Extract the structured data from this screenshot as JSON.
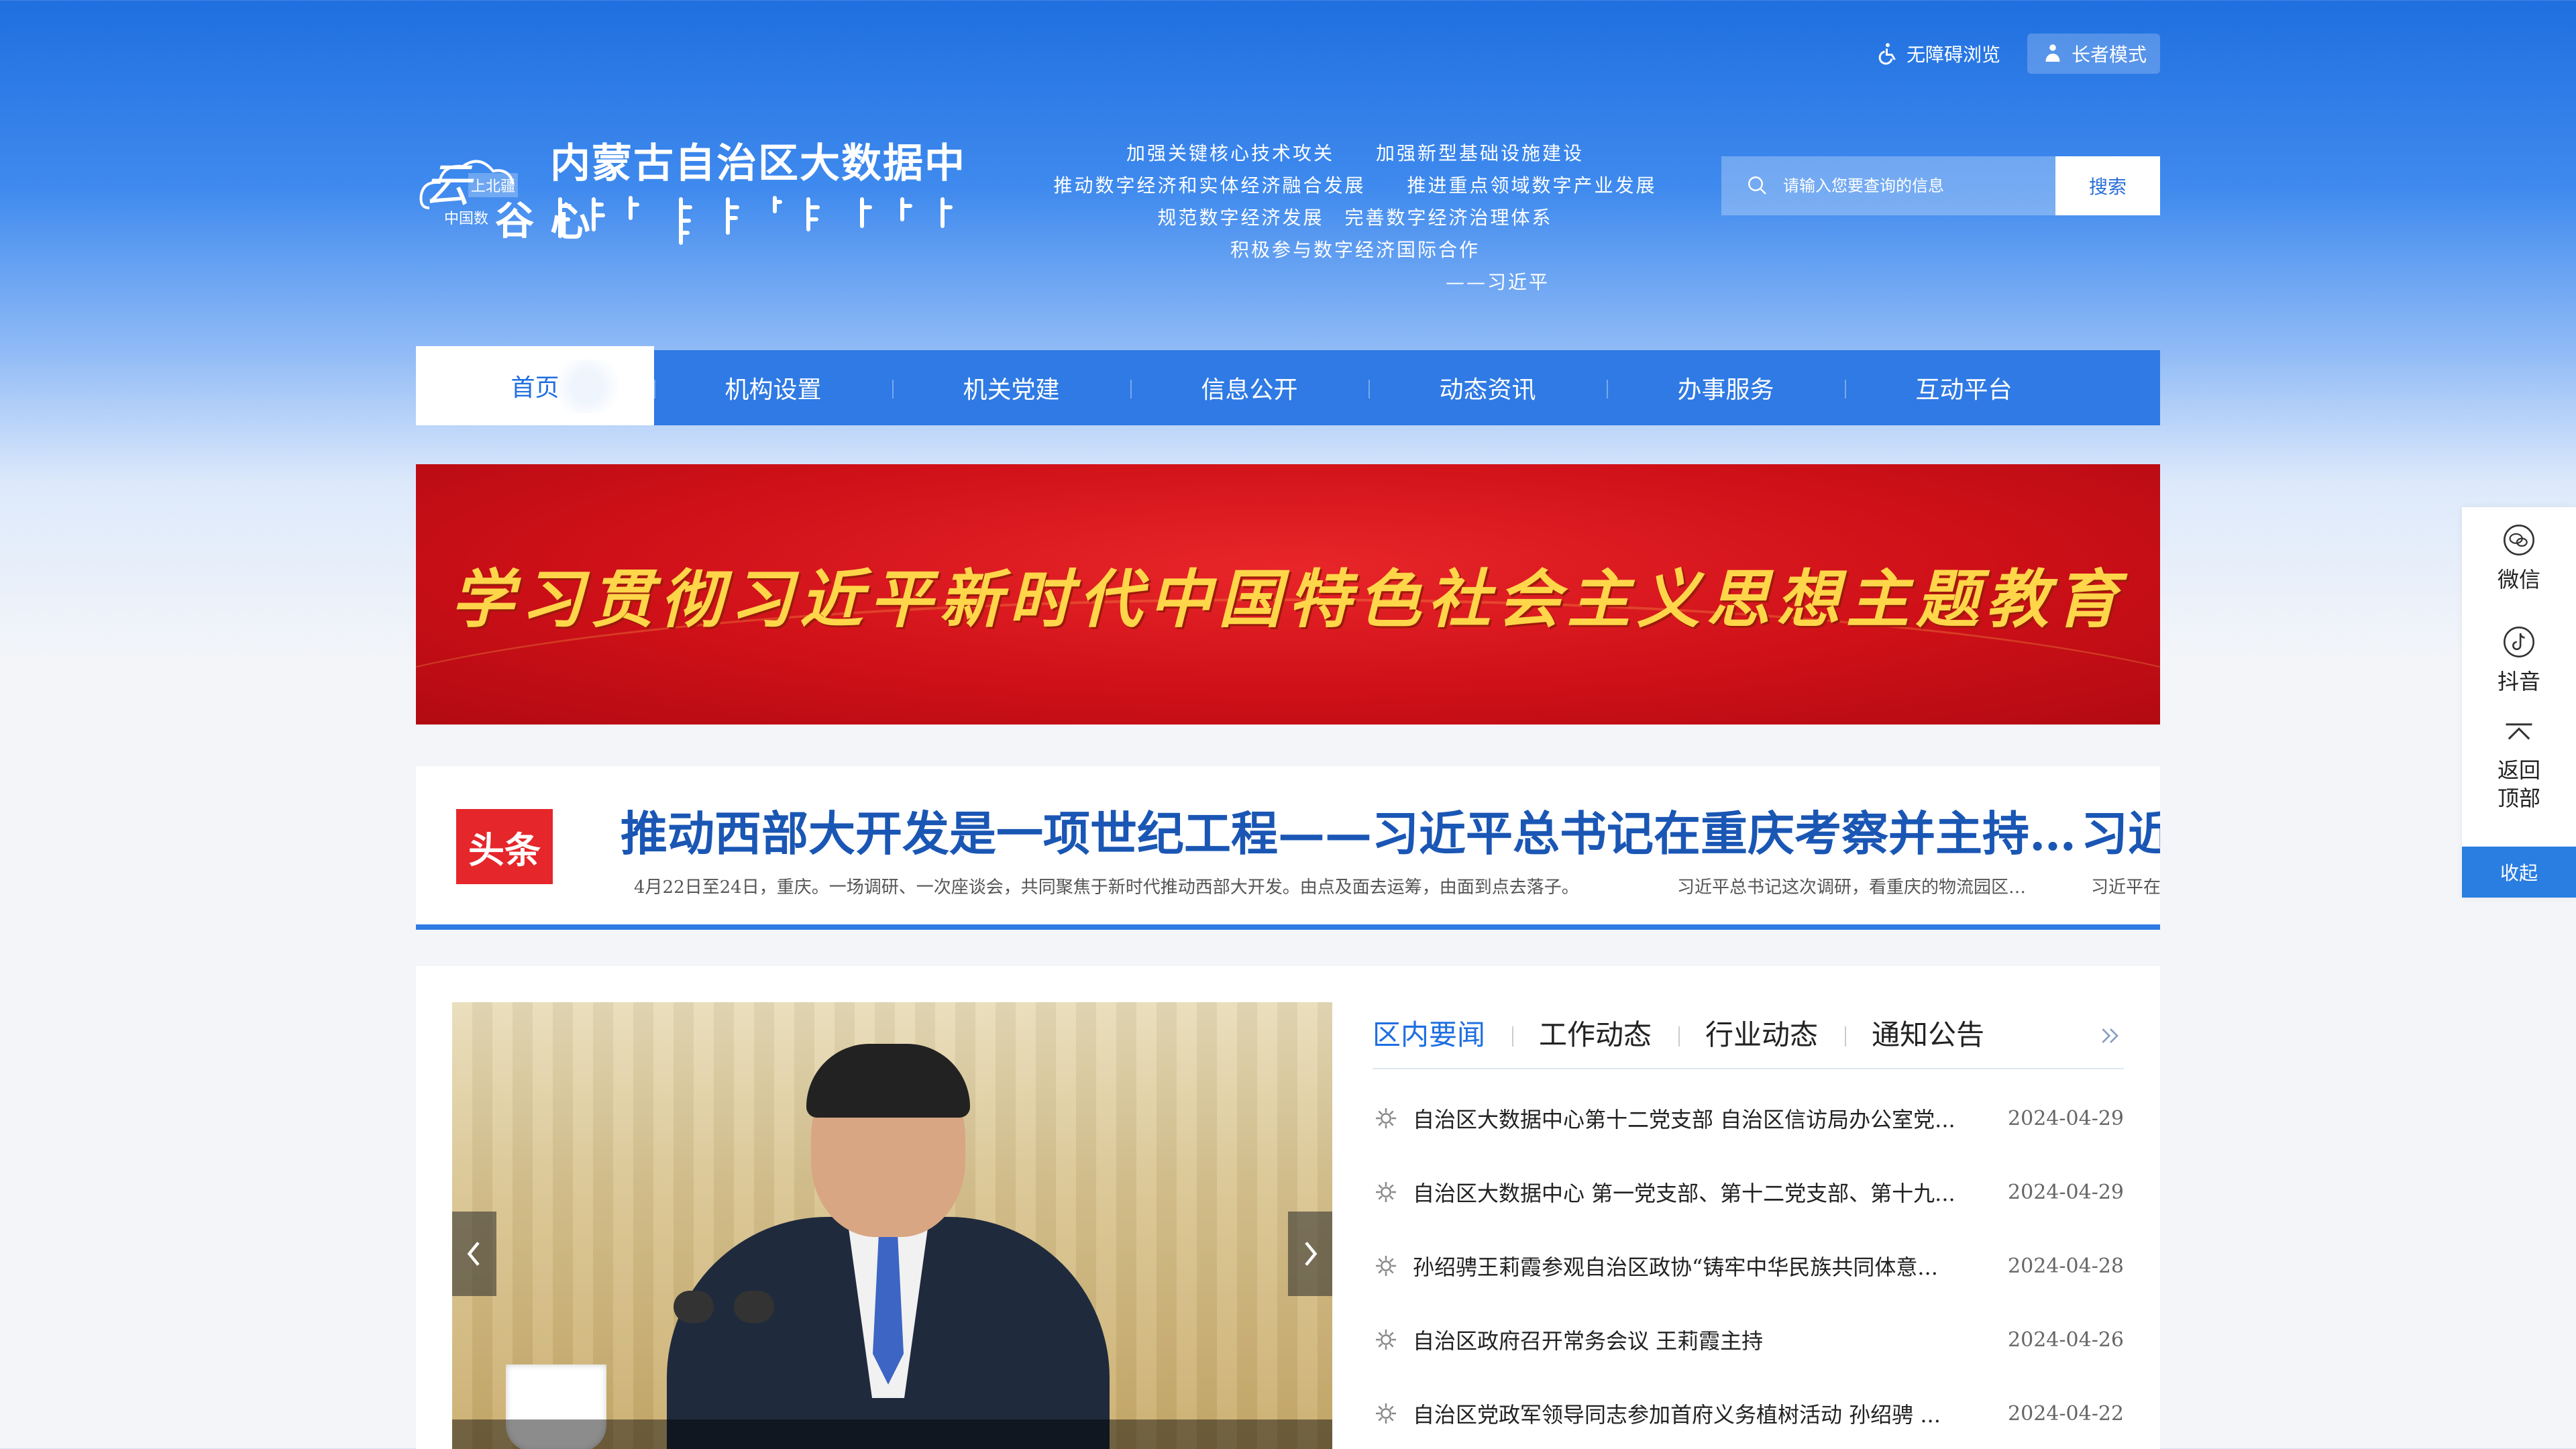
{
  "topbar": {
    "accessible_label": "无障碍浏览",
    "elder_label": "长者模式"
  },
  "logo": {
    "title": "内蒙古自治区大数据中心",
    "mark_yun": "云",
    "mark_brand": "上北疆",
    "mark_sub": "中国数",
    "mark_gu": "谷"
  },
  "slogan": {
    "lines": [
      "加强关键核心技术攻关　　加强新型基础设施建设",
      "推动数字经济和实体经济融合发展　　推进重点领域数字产业发展",
      "规范数字经济发展　完善数字经济治理体系",
      "积极参与数字经济国际合作"
    ],
    "author": "——习近平"
  },
  "search": {
    "placeholder": "请输入您要查询的信息",
    "button": "搜索"
  },
  "nav": {
    "items": [
      {
        "label": "首页"
      },
      {
        "label": "机构设置"
      },
      {
        "label": "机关党建"
      },
      {
        "label": "信息公开"
      },
      {
        "label": "动态资讯"
      },
      {
        "label": "办事服务"
      },
      {
        "label": "互动平台"
      }
    ]
  },
  "banner": {
    "text": "学习贯彻习近平新时代中国特色社会主义思想主题教育"
  },
  "headline": {
    "badge": "头条",
    "title": "推动西部大开发是一项世纪工程——习近平总书记在重庆考察并主持…",
    "title_next": "习近",
    "summaries": [
      "4月22日至24日，重庆。一场调研、一次座谈会，共同聚焦于新时代推动西部大开发。由点及面去运筹，由面到点去落子。",
      "习近平总书记这次调研，看重庆的物流园区…",
      "习近平在"
    ]
  },
  "news": {
    "tabs": [
      "区内要闻",
      "工作动态",
      "行业动态",
      "通知公告"
    ],
    "items": [
      {
        "title": "自治区大数据中心第十二党支部 自治区信访局办公室党...",
        "date": "2024-04-29"
      },
      {
        "title": "自治区大数据中心 第一党支部、第十二党支部、第十九...",
        "date": "2024-04-29"
      },
      {
        "title": "孙绍骋王莉霞参观自治区政协“铸牢中华民族共同体意...",
        "date": "2024-04-28"
      },
      {
        "title": "自治区政府召开常务会议 王莉霞主持",
        "date": "2024-04-26"
      },
      {
        "title": "自治区党政军领导同志参加首府义务植树活动 孙绍骋 ...",
        "date": "2024-04-22"
      }
    ]
  },
  "float": {
    "wechat": "微信",
    "douyin": "抖音",
    "back_top_1": "返回",
    "back_top_2": "顶部",
    "collapse": "收起"
  },
  "colors": {
    "primary": "#2f7ae4",
    "headline_text": "#1a56b4",
    "badge_red": "#e5262a",
    "banner_gold": "#ffd64a"
  }
}
